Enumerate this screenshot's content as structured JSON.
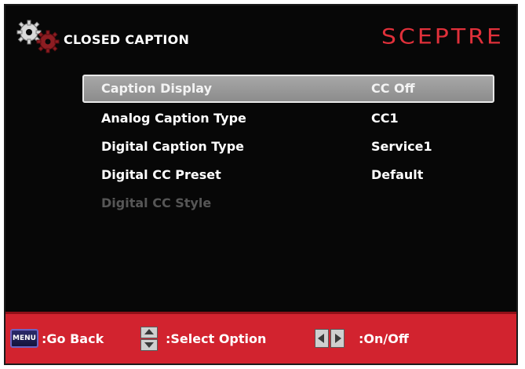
{
  "header": {
    "title": "CLOSED CAPTION",
    "brand": "SCEPTRE",
    "icon": "gear-icon"
  },
  "menu": {
    "items": [
      {
        "label": "Caption Display",
        "value": "CC Off",
        "state": "selected"
      },
      {
        "label": "Analog Caption Type",
        "value": "CC1",
        "state": "normal"
      },
      {
        "label": "Digital Caption Type",
        "value": "Service1",
        "state": "normal"
      },
      {
        "label": "Digital CC Preset",
        "value": "Default",
        "state": "normal"
      },
      {
        "label": "Digital CC Style",
        "value": "",
        "state": "disabled"
      }
    ]
  },
  "footer": {
    "menu_key": "MENU",
    "back_label": ":Go Back",
    "select_label": ":Select Option",
    "onoff_label": ":On/Off"
  },
  "colors": {
    "background": "#070707",
    "footer": "#d2232f",
    "brand": "#e0303a",
    "selected_row": "#9a9a9a",
    "disabled_text": "#565656"
  }
}
